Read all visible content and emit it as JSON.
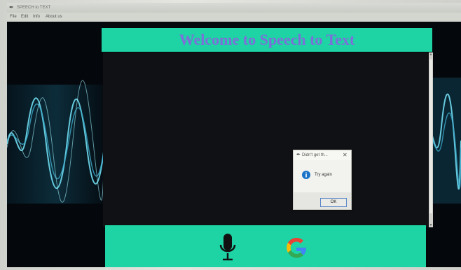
{
  "window": {
    "title": "SPEECH to TEXT",
    "menu": [
      "File",
      "Edit",
      "Info",
      "About us"
    ]
  },
  "header": {
    "title": "Welcome to Speech to Text"
  },
  "main": {
    "transcript": ""
  },
  "footer": {
    "buttons": [
      {
        "name": "microphone",
        "icon": "microphone-icon"
      },
      {
        "name": "google",
        "icon": "google-icon"
      }
    ]
  },
  "dialog": {
    "title": "Didn't get th...",
    "message": "Try again",
    "ok_label": "OK",
    "icon": "info-icon"
  },
  "colors": {
    "accent": "#1ed3a4",
    "title_text": "#7d6fd9",
    "background": "#05070b",
    "wave": "#5fd6e8"
  }
}
